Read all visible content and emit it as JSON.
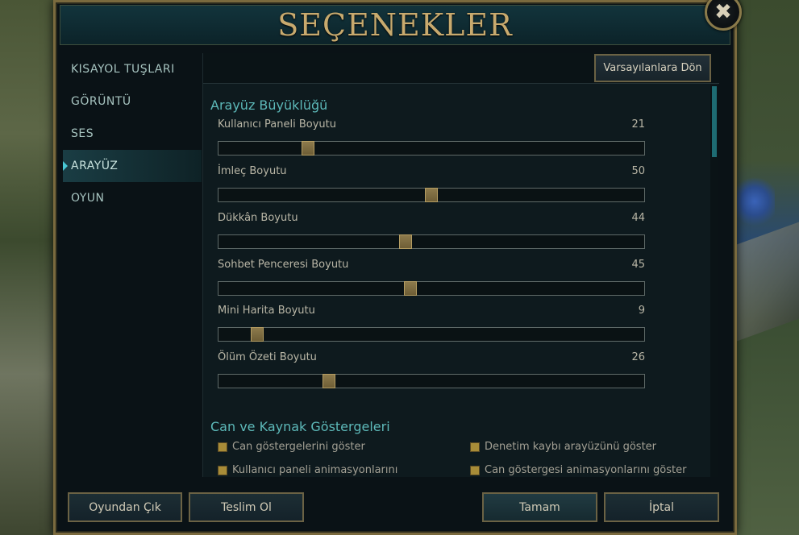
{
  "title": "SEÇENEKLER",
  "close_glyph": "✖",
  "sidebar": {
    "items": [
      {
        "label": "KISAYOL TUŞLARI",
        "active": false
      },
      {
        "label": "GÖRÜNTÜ",
        "active": false
      },
      {
        "label": "SES",
        "active": false
      },
      {
        "label": "ARAYÜZ",
        "active": true
      },
      {
        "label": "OYUN",
        "active": false
      }
    ]
  },
  "header": {
    "reset_label": "Varsayılanlara Dön"
  },
  "section_size": {
    "title": "Arayüz Büyüklüğü",
    "sliders": [
      {
        "label": "Kullanıcı Paneli Boyutu",
        "value": "21",
        "level": 0.21
      },
      {
        "label": "İmleç Boyutu",
        "value": "50",
        "level": 0.5
      },
      {
        "label": "Dükkân Boyutu",
        "value": "44",
        "level": 0.44
      },
      {
        "label": "Sohbet Penceresi Boyutu",
        "value": "45",
        "level": 0.45
      },
      {
        "label": "Mini Harita Boyutu",
        "value": "9",
        "level": 0.09
      },
      {
        "label": "Ölüm Özeti Boyutu",
        "value": "26",
        "level": 0.26
      }
    ]
  },
  "section_bars": {
    "title": "Can ve Kaynak Göstergeleri",
    "checks": [
      {
        "label": "Can göstergelerini göster",
        "checked": true
      },
      {
        "label": "Denetim kaybı arayüzünü göster",
        "checked": true
      },
      {
        "label": "Kullanıcı paneli animasyonlarını",
        "checked": true
      },
      {
        "label": "Can göstergesi animasyonlarını göster",
        "checked": true
      }
    ]
  },
  "footer": {
    "quit_label": "Oyundan Çık",
    "surrender_label": "Teslim Ol",
    "ok_label": "Tamam",
    "cancel_label": "İptal"
  },
  "colors": {
    "accent_gold": "#c8aa6e",
    "accent_teal": "#5db9b9",
    "checkbox_gold": "#a88c38"
  }
}
